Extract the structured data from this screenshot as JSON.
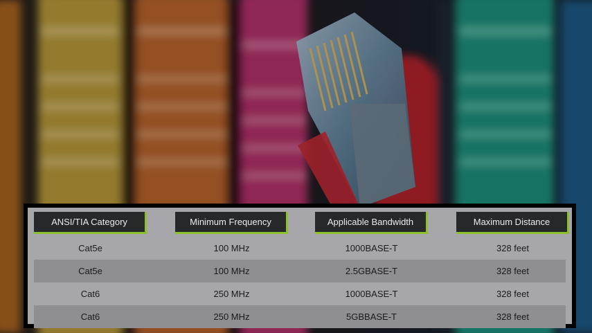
{
  "table": {
    "headers": [
      "ANSI/TIA Category",
      "Minimum Frequency",
      "Applicable Bandwidth",
      "Maximum Distance"
    ],
    "rows": [
      [
        "Cat5e",
        "100 MHz",
        "1000BASE-T",
        "328 feet"
      ],
      [
        "Cat5e",
        "100 MHz",
        "2.5GBASE-T",
        "328 feet"
      ],
      [
        "Cat6",
        "250 MHz",
        "1000BASE-T",
        "328 feet"
      ],
      [
        "Cat6",
        "250 MHz",
        "5GBBASE-T",
        "328 feet"
      ]
    ]
  },
  "colors": {
    "header_bg": "#26282a",
    "header_accent": "#8bbf2b",
    "table_bg": "#a7a7ab",
    "row_alt_bg": "#8e8e93"
  },
  "image": {
    "subject": "ethernet-cables-photo"
  }
}
